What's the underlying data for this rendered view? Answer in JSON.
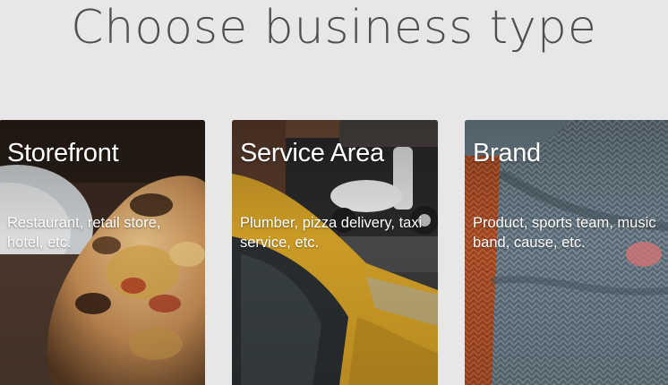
{
  "page": {
    "title": "Choose business type"
  },
  "cards": [
    {
      "id": "storefront",
      "title": "Storefront",
      "description": "Restaurant, retail store, hotel, etc."
    },
    {
      "id": "service",
      "title": "Service Area",
      "description": "Plumber, pizza delivery, taxi service, etc."
    },
    {
      "id": "brand",
      "title": "Brand",
      "description": "Product, sports team, music band, cause, etc."
    }
  ],
  "colors": {
    "background": "#e7e7e7",
    "title": "#4f4f4f",
    "card_text": "#ffffff"
  }
}
